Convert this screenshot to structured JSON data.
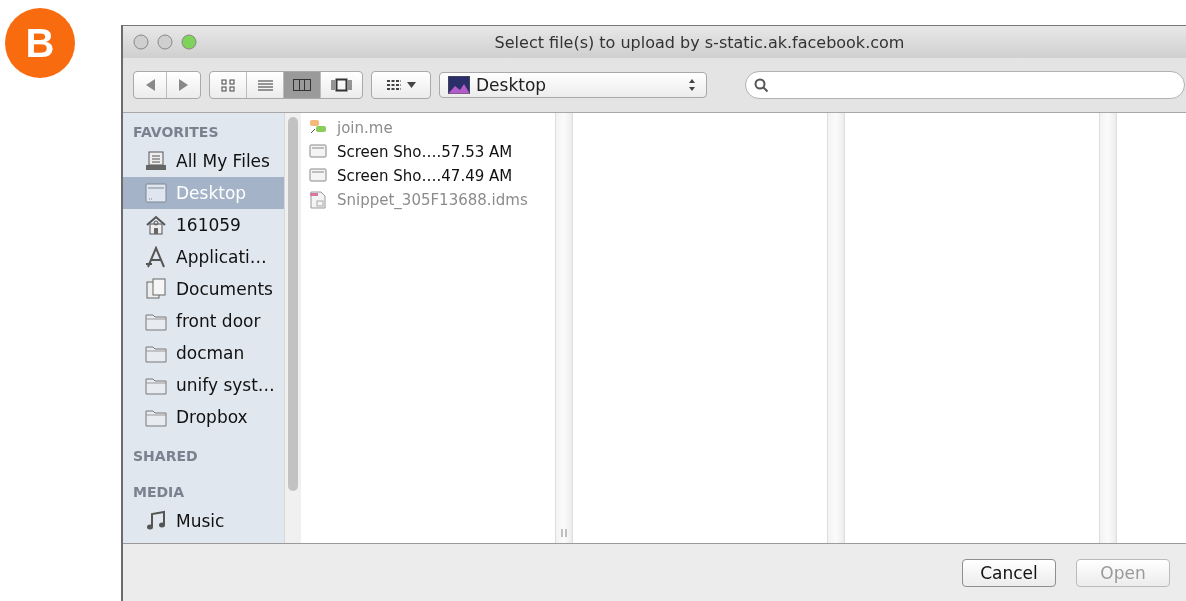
{
  "badge": {
    "label": "B"
  },
  "window": {
    "title": "Select file(s) to upload by s-static.ak.facebook.com"
  },
  "toolbar": {
    "view_buttons": [
      {
        "kind": "icons",
        "selected": false
      },
      {
        "kind": "list",
        "selected": false
      },
      {
        "kind": "columns",
        "selected": true
      },
      {
        "kind": "coverflow",
        "selected": false
      }
    ],
    "location": "Desktop"
  },
  "sidebar": {
    "sections": [
      {
        "heading": "FAVORITES",
        "items": [
          {
            "label": "All My Files",
            "kind": "allfiles",
            "selected": false
          },
          {
            "label": "Desktop",
            "kind": "desktop",
            "selected": true
          },
          {
            "label": "161059",
            "kind": "home",
            "selected": false
          },
          {
            "label": "Applicati…",
            "kind": "apps",
            "selected": false
          },
          {
            "label": "Documents",
            "kind": "documents",
            "selected": false
          },
          {
            "label": "front door",
            "kind": "folder",
            "selected": false
          },
          {
            "label": "docman",
            "kind": "folder",
            "selected": false
          },
          {
            "label": "unify syst…",
            "kind": "folder",
            "selected": false
          },
          {
            "label": "Dropbox",
            "kind": "folder",
            "selected": false
          }
        ]
      },
      {
        "heading": "SHARED"
      },
      {
        "heading": "MEDIA",
        "items": [
          {
            "label": "Music",
            "kind": "music",
            "selected": false
          }
        ]
      }
    ]
  },
  "files": [
    {
      "name": "join.me",
      "kind": "app",
      "disabled": true
    },
    {
      "name": "Screen Sho….57.53 AM",
      "kind": "screenshot",
      "disabled": false
    },
    {
      "name": "Screen Sho….47.49 AM",
      "kind": "screenshot",
      "disabled": false
    },
    {
      "name": "Snippet_305F13688.idms",
      "kind": "document",
      "disabled": true
    }
  ],
  "buttons": [
    {
      "label": "Cancel",
      "disabled": false
    },
    {
      "label": "Open",
      "disabled": true
    }
  ]
}
